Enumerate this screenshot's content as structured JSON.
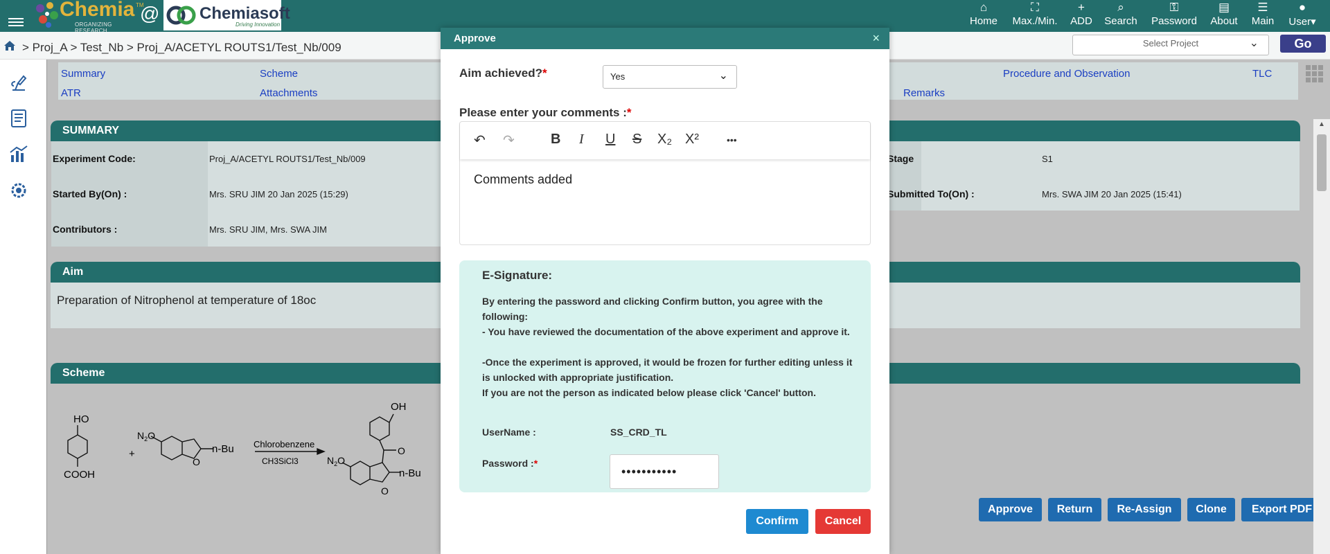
{
  "header": {
    "logo_text": "Chemia",
    "logo_tm": "TM",
    "logo_tagline": "ORGANIZING RESEARCH",
    "at": "@",
    "partner_logo": "Chemiasoft",
    "partner_tagline": "Driving Innovation",
    "nav": [
      {
        "label": "Home",
        "icon": "home-icon"
      },
      {
        "label": "Max./Min.",
        "icon": "expand-icon"
      },
      {
        "label": "ADD",
        "icon": "plus-icon"
      },
      {
        "label": "Search",
        "icon": "search-icon"
      },
      {
        "label": "Password",
        "icon": "key-icon"
      },
      {
        "label": "About",
        "icon": "id-card-icon"
      },
      {
        "label": "Main",
        "icon": "menu-icon"
      },
      {
        "label": "User",
        "icon": "user-icon"
      }
    ]
  },
  "breadcrumb": {
    "path": "> Proj_A > Test_Nb > Proj_A/ACETYL ROUTS1/Test_Nb/009"
  },
  "project_select": {
    "placeholder": "Select Project"
  },
  "go_label": "Go",
  "tabs": [
    "Summary",
    "Scheme",
    "Procedure and Observation",
    "TLC",
    "ATR",
    "Attachments",
    "Remarks"
  ],
  "summary": {
    "title": "SUMMARY",
    "experiment_code_label": "Experiment Code:",
    "experiment_code": "Proj_A/ACETYL ROUTS1/Test_Nb/009",
    "started_by_label": "Started By(On) :",
    "started_by": "Mrs. SRU JIM 20 Jan 2025 (15:29)",
    "contributors_label": "Contributors :",
    "contributors": "Mrs. SRU JIM, Mrs. SWA JIM",
    "stage_label": "Stage",
    "stage": "S1",
    "submitted_to_label": "Submitted To(On) :",
    "submitted_to": "Mrs. SWA JIM 20 Jan 2025 (15:41)"
  },
  "aim": {
    "title": "Aim",
    "text": "Preparation of Nitrophenol at temperature of 18oc"
  },
  "scheme": {
    "title": "Scheme",
    "labels": {
      "ho": "HO",
      "cooh": "COOH",
      "plus": "+",
      "no2": "O",
      "no2sub": "2",
      "n": "N",
      "nbu": "n-Bu",
      "solvent": "Chlorobenzene",
      "reagent": "CH3SiCl3",
      "oh": "OH",
      "o": "O",
      "carbonyl_o": "O"
    }
  },
  "actions": [
    "Approve",
    "Return",
    "Re-Assign",
    "Clone",
    "Export PDF"
  ],
  "modal": {
    "title": "Approve",
    "close": "×",
    "aim_label": "Aim achieved?",
    "required": "*",
    "aim_value": "Yes",
    "comments_label": "Please enter your comments :",
    "comments": "Comments added",
    "toolbar": {
      "undo": "↶",
      "redo": "↷",
      "bold": "B",
      "italic": "I",
      "underline": "U",
      "strike": "S",
      "sub": "X₂",
      "sup": "X²",
      "more": "•••"
    },
    "esig": {
      "title": "E-Signature:",
      "line1": "By entering the password and clicking Confirm button, you agree with the following:",
      "line2": "- You have reviewed the documentation of the above experiment and approve it.",
      "line3": "-Once the experiment is approved, it would be frozen for further editing unless it is unlocked with appropriate justification.",
      "line4": "If you are not the person as indicated below please click 'Cancel' button.",
      "username_label": "UserName :",
      "username": "SS_CRD_TL",
      "password_label": "Password :",
      "password": "•••••••••••"
    },
    "confirm": "Confirm",
    "cancel": "Cancel"
  }
}
